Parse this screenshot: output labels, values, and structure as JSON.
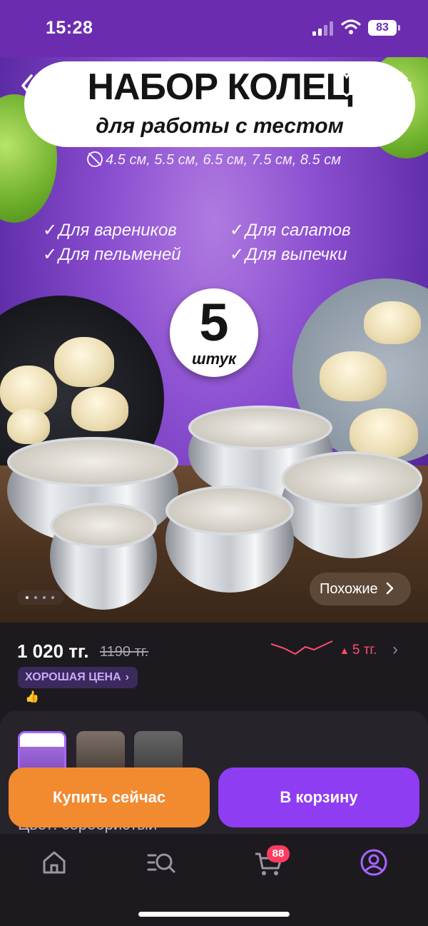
{
  "status_bar": {
    "time": "15:28",
    "battery": "83"
  },
  "product_image": {
    "title": "НАБОР КОЛЕЦ",
    "subtitle": "для работы с тестом",
    "sizes": "4.5 см, 5.5 см, 6.5 см, 7.5 см, 8.5 см",
    "features": [
      "Для вареников",
      "Для салатов",
      "Для пельменей",
      "Для выпечки"
    ],
    "badge_number": "5",
    "badge_unit": "штук",
    "similar_label": "Похожие",
    "similar_icon": "chevron-right-icon",
    "pager": {
      "total": 4,
      "active": 1
    }
  },
  "price": {
    "current": "1 020 тг.",
    "old": "1190 тг.",
    "trend_change": "5 тг.",
    "trend_color": "#ff4d6a",
    "good_price_label": "ХОРОШАЯ ЦЕНА"
  },
  "variants": {
    "color_label": "Цвет: серебристый",
    "thumbnails": 3,
    "selected": 1
  },
  "actions": {
    "buy_now": "Купить сейчас",
    "add_to_cart": "В корзину"
  },
  "tab_bar": {
    "items": [
      "home-icon",
      "catalog-search-icon",
      "cart-icon",
      "profile-icon"
    ],
    "cart_count": "88"
  },
  "colors": {
    "accent": "#8f3df2",
    "buy_now": "#f28a2f",
    "status_bar": "#6c2cb0",
    "badge": "#ff3b62"
  }
}
